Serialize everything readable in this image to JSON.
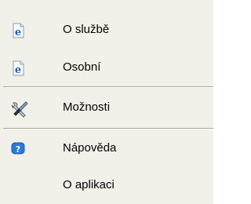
{
  "menu": {
    "items": [
      {
        "label": "O službě",
        "icon": "ie-page-icon"
      },
      {
        "label": "Osobní",
        "icon": "ie-page-icon"
      },
      {
        "label": "Možnosti",
        "icon": "tools-icon"
      },
      {
        "label": "Nápověda",
        "icon": "help-icon"
      },
      {
        "label": "O aplikaci",
        "icon": "none"
      }
    ]
  },
  "colors": {
    "menu_background": "#f1f0e9",
    "separator": "#aca899",
    "ie_blue": "#1f5fc2",
    "help_blue": "#2a7ad6"
  }
}
